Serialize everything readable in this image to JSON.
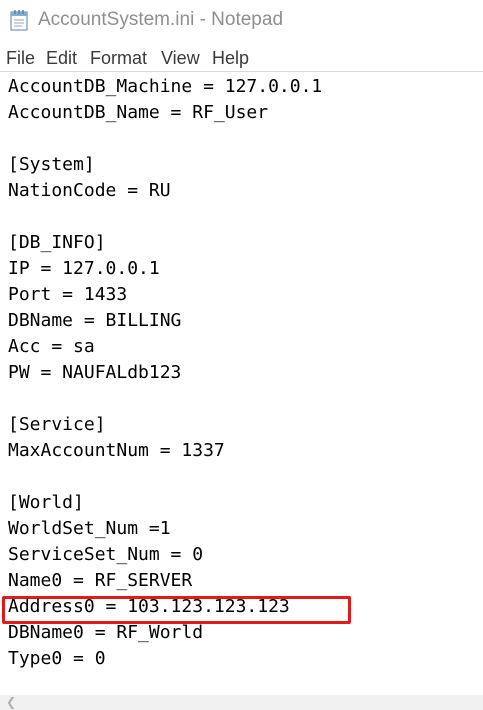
{
  "window": {
    "title": "AccountSystem.ini - Notepad"
  },
  "menu": {
    "file": "File",
    "edit": "Edit",
    "format": "Format",
    "view": "View",
    "help": "Help"
  },
  "editor": {
    "lines": [
      "AccountDB_Machine = 127.0.0.1",
      "AccountDB_Name = RF_User",
      "",
      "[System]",
      "NationCode = RU",
      "",
      "[DB_INFO]",
      "IP = 127.0.0.1",
      "Port = 1433",
      "DBName = BILLING",
      "Acc = sa",
      "PW = NAUFALdb123",
      "",
      "[Service]",
      "MaxAccountNum = 1337",
      "",
      "[World]",
      "WorldSet_Num =1",
      "ServiceSet_Num = 0",
      "Name0 = RF_SERVER",
      "Address0 = 103.123.123.123",
      "DBName0 = RF_World",
      "Type0 = 0"
    ]
  },
  "annotation": {
    "highlight_color": "#e31a1a"
  },
  "colors": {
    "title_text": "#8f8f8f",
    "menu_text": "#3a3a3a",
    "editor_text": "#000000",
    "background": "#ffffff"
  },
  "icons": {
    "app": "notepad-icon",
    "scroll_left": "chevron-left-icon"
  }
}
